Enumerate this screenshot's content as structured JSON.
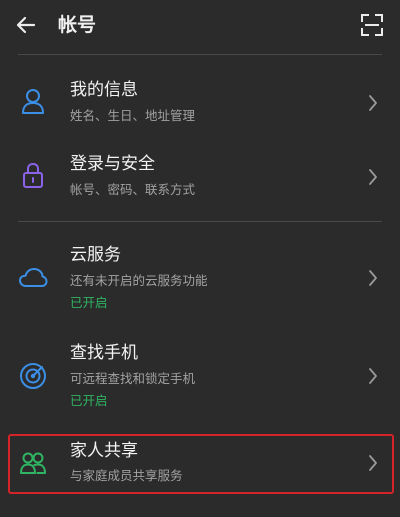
{
  "header": {
    "title": "帐号",
    "back_icon": "arrow-left-icon",
    "scan_icon": "scan-icon"
  },
  "colors": {
    "background": "#2b2b2b",
    "accent_blue": "#3b8fe6",
    "accent_purple": "#8a63e8",
    "status_green": "#2fb563",
    "highlight_red": "#d6232a"
  },
  "items": [
    {
      "title": "我的信息",
      "subtitle": "姓名、生日、地址管理",
      "icon": "person-icon"
    },
    {
      "title": "登录与安全",
      "subtitle": "帐号、密码、联系方式",
      "icon": "lock-icon"
    },
    {
      "title": "云服务",
      "subtitle": "还有未开启的云服务功能",
      "status": "已开启",
      "icon": "cloud-icon"
    },
    {
      "title": "查找手机",
      "subtitle": "可远程查找和锁定手机",
      "status": "已开启",
      "icon": "radar-icon"
    },
    {
      "title": "家人共享",
      "subtitle": "与家庭成员共享服务",
      "icon": "family-icon"
    }
  ]
}
